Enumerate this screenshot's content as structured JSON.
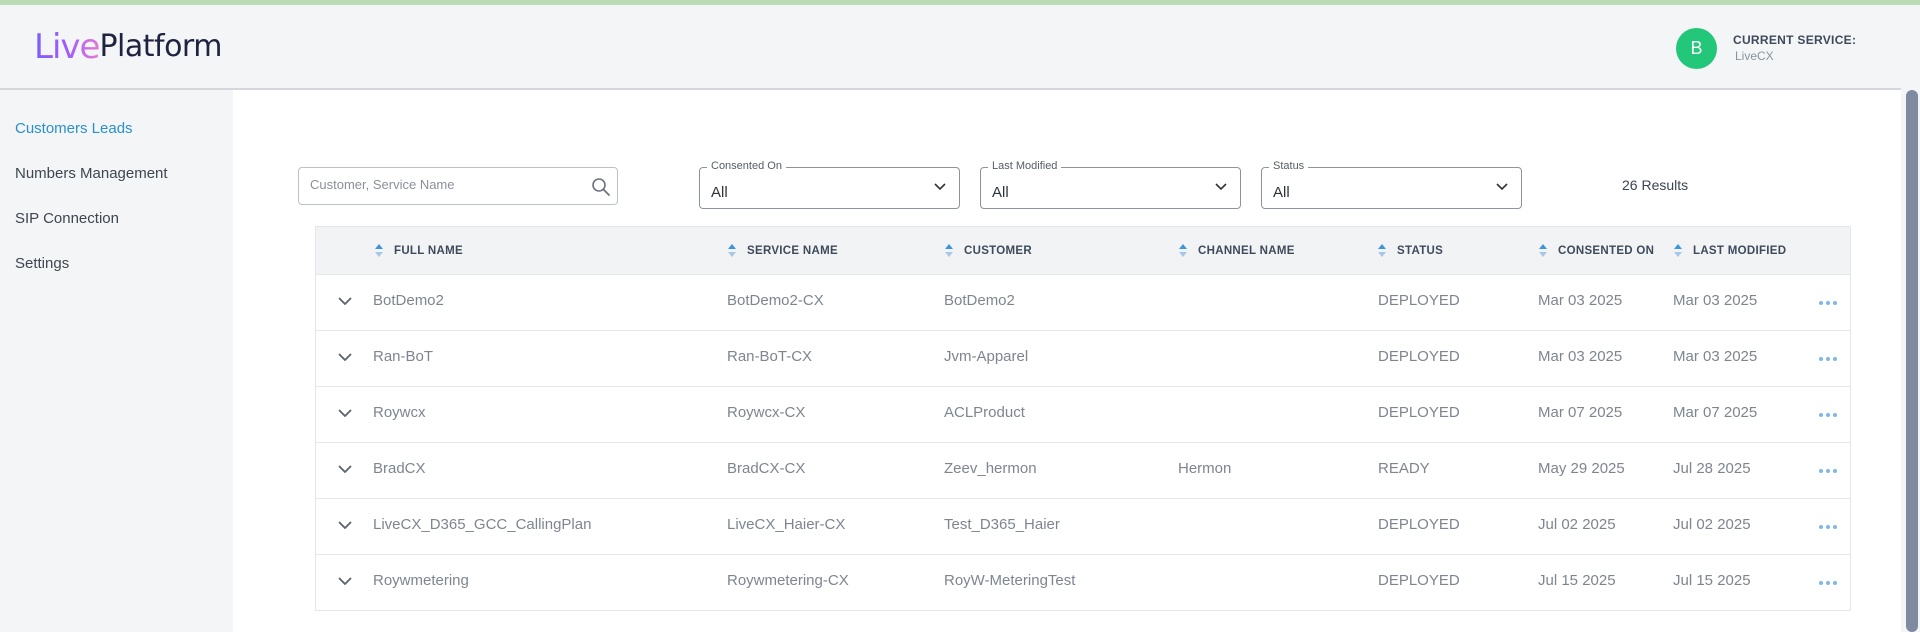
{
  "header": {
    "logo_live": "Live",
    "logo_platform": "Platform",
    "avatar_initial": "B",
    "current_service_label": "CURRENT SERVICE:",
    "current_service_name": "LiveCX"
  },
  "sidebar": {
    "items": [
      {
        "label": "Customers Leads",
        "active": true
      },
      {
        "label": "Numbers Management",
        "active": false
      },
      {
        "label": "SIP Connection",
        "active": false
      },
      {
        "label": "Settings",
        "active": false
      }
    ]
  },
  "filters": {
    "search_placeholder": "Customer, Service Name",
    "consented_on": {
      "label": "Consented On",
      "value": "All"
    },
    "last_modified": {
      "label": "Last Modified",
      "value": "All"
    },
    "status": {
      "label": "Status",
      "value": "All"
    },
    "results": "26 Results"
  },
  "table": {
    "columns": [
      "FULL NAME",
      "SERVICE NAME",
      "CUSTOMER",
      "CHANNEL NAME",
      "STATUS",
      "CONSENTED ON",
      "LAST MODIFIED"
    ],
    "rows": [
      {
        "full_name": "BotDemo2",
        "service_name": "BotDemo2-CX",
        "customer": "BotDemo2",
        "channel_name": "",
        "status": "DEPLOYED",
        "consented_on": "Mar 03 2025",
        "last_modified": "Mar 03 2025"
      },
      {
        "full_name": "Ran-BoT",
        "service_name": "Ran-BoT-CX",
        "customer": "Jvm-Apparel",
        "channel_name": "",
        "status": "DEPLOYED",
        "consented_on": "Mar 03 2025",
        "last_modified": "Mar 03 2025"
      },
      {
        "full_name": "Roywcx",
        "service_name": "Roywcx-CX",
        "customer": "ACLProduct",
        "channel_name": "",
        "status": "DEPLOYED",
        "consented_on": "Mar 07 2025",
        "last_modified": "Mar 07 2025"
      },
      {
        "full_name": "BradCX",
        "service_name": "BradCX-CX",
        "customer": "Zeev_hermon",
        "channel_name": "Hermon",
        "status": "READY",
        "consented_on": "May 29 2025",
        "last_modified": "Jul 28 2025"
      },
      {
        "full_name": "LiveCX_D365_GCC_CallingPlan",
        "service_name": "LiveCX_Haier-CX",
        "customer": "Test_D365_Haier",
        "channel_name": "",
        "status": "DEPLOYED",
        "consented_on": "Jul 02 2025",
        "last_modified": "Jul 02 2025"
      },
      {
        "full_name": "Roywmetering",
        "service_name": "Roywmetering-CX",
        "customer": "RoyW-MeteringTest",
        "channel_name": "",
        "status": "DEPLOYED",
        "consented_on": "Jul 15 2025",
        "last_modified": "Jul 15 2025"
      }
    ]
  },
  "colors": {
    "accent": "#2a91c8",
    "avatar": "#22c77a",
    "more_dots": "#7fb8e6"
  }
}
